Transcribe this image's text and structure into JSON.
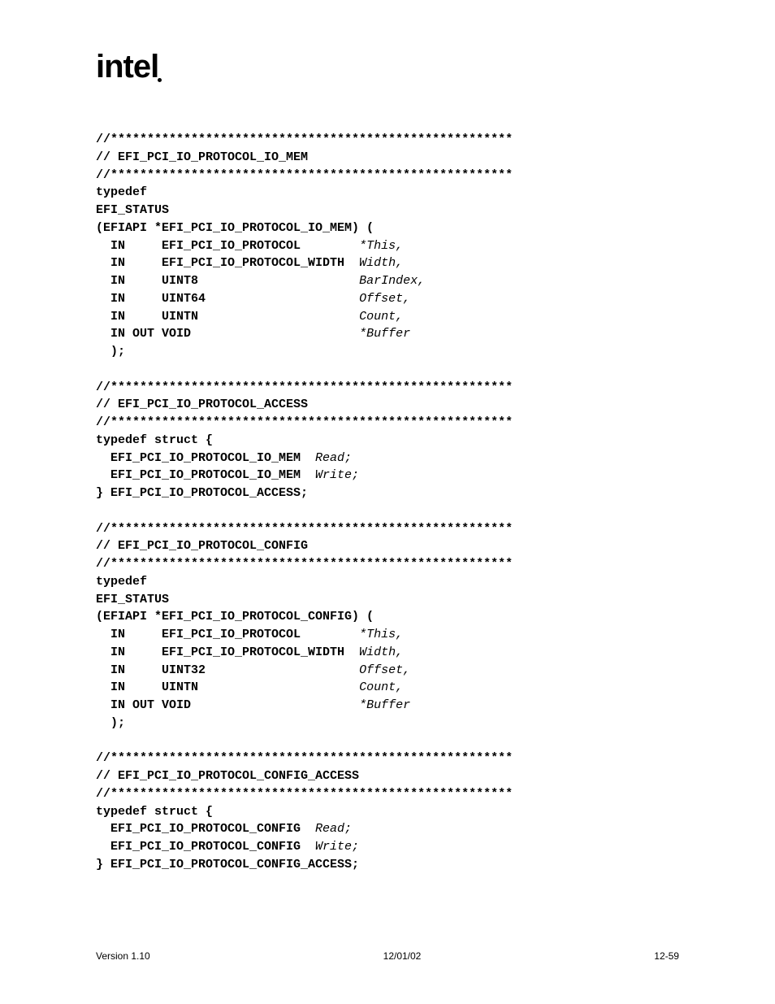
{
  "logo": "intel",
  "code": {
    "stars1": "//*******************************************************",
    "c1": "// EFI_PCI_IO_PROTOCOL_IO_MEM",
    "stars2": "//*******************************************************",
    "t1a": "typedef",
    "t1b": "EFI_STATUS",
    "t1c": "(EFIAPI *EFI_PCI_IO_PROTOCOL_IO_MEM) (",
    "r1a_k": "  IN     EFI_PCI_IO_PROTOCOL        ",
    "r1a_v": "*This,",
    "r1b_k": "  IN     EFI_PCI_IO_PROTOCOL_WIDTH  ",
    "r1b_v": "Width,",
    "r1c_k": "  IN     UINT8                      ",
    "r1c_v": "BarIndex,",
    "r1d_k": "  IN     UINT64                     ",
    "r1d_v": "Offset,",
    "r1e_k": "  IN     UINTN                      ",
    "r1e_v": "Count,",
    "r1f_k": "  IN OUT VOID                       ",
    "r1f_v": "*Buffer",
    "t1d": "  );",
    "stars3": "//*******************************************************",
    "c2": "// EFI_PCI_IO_PROTOCOL_ACCESS",
    "stars4": "//*******************************************************",
    "t2a": "typedef struct {",
    "r2a_k": "  EFI_PCI_IO_PROTOCOL_IO_MEM  ",
    "r2a_v": "Read;",
    "r2b_k": "  EFI_PCI_IO_PROTOCOL_IO_MEM  ",
    "r2b_v": "Write;",
    "t2b": "} EFI_PCI_IO_PROTOCOL_ACCESS;",
    "stars5": "//*******************************************************",
    "c3": "// EFI_PCI_IO_PROTOCOL_CONFIG",
    "stars6": "//*******************************************************",
    "t3a": "typedef",
    "t3b": "EFI_STATUS",
    "t3c": "(EFIAPI *EFI_PCI_IO_PROTOCOL_CONFIG) (",
    "r3a_k": "  IN     EFI_PCI_IO_PROTOCOL        ",
    "r3a_v": "*This,",
    "r3b_k": "  IN     EFI_PCI_IO_PROTOCOL_WIDTH  ",
    "r3b_v": "Width,",
    "r3c_k": "  IN     UINT32                     ",
    "r3c_v": "Offset,",
    "r3d_k": "  IN     UINTN                      ",
    "r3d_v": "Count,",
    "r3e_k": "  IN OUT VOID                       ",
    "r3e_v": "*Buffer",
    "t3d": "  );",
    "stars7": "//*******************************************************",
    "c4": "// EFI_PCI_IO_PROTOCOL_CONFIG_ACCESS",
    "stars8": "//*******************************************************",
    "t4a": "typedef struct {",
    "r4a_k": "  EFI_PCI_IO_PROTOCOL_CONFIG  ",
    "r4a_v": "Read;",
    "r4b_k": "  EFI_PCI_IO_PROTOCOL_CONFIG  ",
    "r4b_v": "Write;",
    "t4b": "} EFI_PCI_IO_PROTOCOL_CONFIG_ACCESS;"
  },
  "footer": {
    "left": "Version 1.10",
    "center": "12/01/02",
    "right": "12-59"
  }
}
